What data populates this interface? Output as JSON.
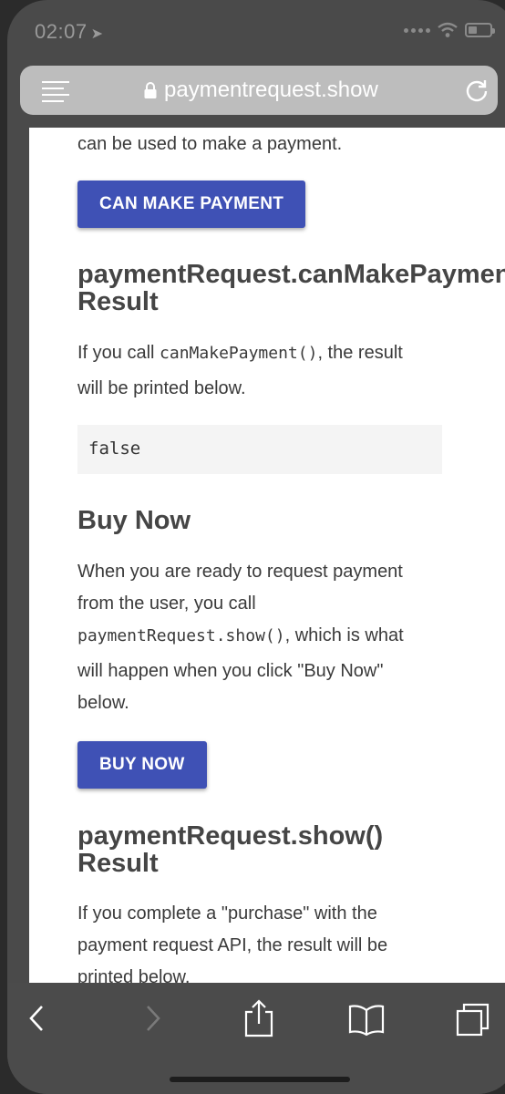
{
  "status_bar": {
    "time": "02:07",
    "location_arrow": "➤"
  },
  "browser": {
    "url": "paymentrequest.show",
    "icons": [
      "menu-icon",
      "lock-icon",
      "reload-icon"
    ]
  },
  "page": {
    "intro_tail": "can be used to make a payment.",
    "can_make_payment_button": "CAN MAKE PAYMENT",
    "can_make_payment_heading_line1": "paymentRequest.canMakePayment()",
    "can_make_payment_heading_line2": "Result",
    "can_make_payment_text_1": "If you call ",
    "can_make_payment_code": "canMakePayment()",
    "can_make_payment_text_2": ", the result",
    "can_make_payment_text_3": "will be printed below.",
    "can_make_payment_result": "false",
    "buy_now_heading": "Buy Now",
    "buy_now_text_1": "When you are ready to request payment",
    "buy_now_text_2": "from the user, you call",
    "buy_now_code": "paymentRequest.show()",
    "buy_now_text_3": ", which is what",
    "buy_now_text_4": "will happen when you click \"Buy Now\"",
    "buy_now_text_5": "below.",
    "buy_now_button": "BUY NOW",
    "show_heading_line1": "paymentRequest.show()",
    "show_heading_line2": "Result",
    "show_text_1": "If you complete a \"purchase\" with the",
    "show_text_2": "payment request API, the result will be",
    "show_text_3": "printed below."
  },
  "toolbar": {
    "icons": [
      "back-icon",
      "forward-icon",
      "share-icon",
      "bookmarks-icon",
      "tabs-icon"
    ]
  },
  "colors": {
    "button": "#3f51b5",
    "chrome": "#4a4a4a",
    "urlbar": "#bdbdbd"
  }
}
